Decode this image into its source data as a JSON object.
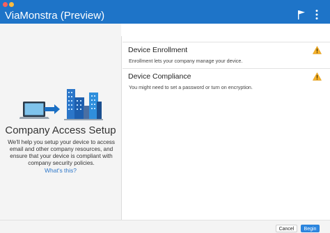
{
  "window": {
    "title": "ViaMonstra (Preview)",
    "accent_color": "#1e74c8"
  },
  "header_icons": {
    "flag": "flag-icon",
    "menu": "vertical-ellipsis-icon"
  },
  "left_panel": {
    "illustration": "laptop-to-city-buildings-illustration",
    "title": "Company Access Setup",
    "description": "We'll help you setup your device to access email and other company resources, and ensure that your device is compliant with company security policies.",
    "link": "What's this?"
  },
  "items": [
    {
      "title": "Device Enrollment",
      "subtitle": "Enrollment lets your company manage your device.",
      "status_icon": "warning-icon"
    },
    {
      "title": "Device Compliance",
      "subtitle": "You might need to set a password or turn on encryption.",
      "status_icon": "warning-icon"
    }
  ],
  "footer": {
    "cancel_label": "Cancel",
    "begin_label": "Begin"
  }
}
